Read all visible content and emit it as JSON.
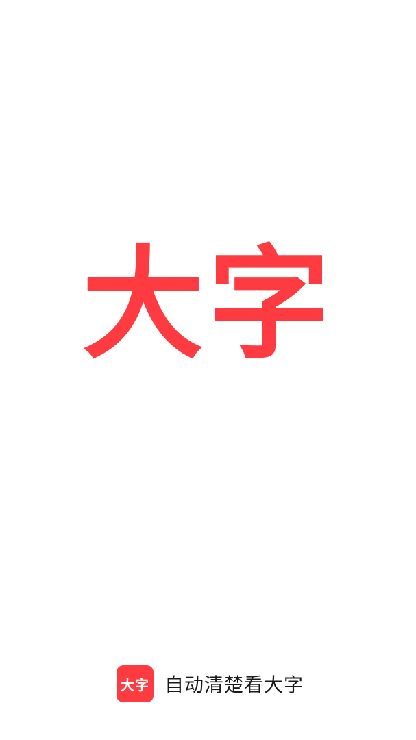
{
  "splash": {
    "title": "大字"
  },
  "footer": {
    "app_icon_text": "大字",
    "slogan": "自动清楚看大字"
  },
  "colors": {
    "brand_red": "#ff3b42",
    "background": "#ffffff",
    "text": "#1a1a1a"
  }
}
